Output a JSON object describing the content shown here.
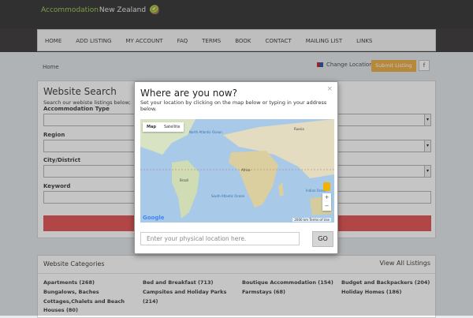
{
  "site": {
    "logo_green": "Accommodation",
    "logo_white": " New Zealand",
    "logo_icon": "kiwi-icon"
  },
  "nav": [
    "HOME",
    "ADD LISTING",
    "MY ACCOUNT",
    "FAQ",
    "TERMS",
    "BOOK",
    "CONTACT",
    "MAILING LIST",
    "LINKS"
  ],
  "breadcrumb": "Home",
  "change_location": "Change Location",
  "submit_listing": "Submit Listing",
  "facebook": "f",
  "search": {
    "title": "Website Search",
    "subtitle": "Search our webiste listings below;",
    "fields": [
      {
        "label": "Accommodation Type"
      },
      {
        "label": "Region"
      },
      {
        "label": "City/District"
      },
      {
        "label": "Keyword"
      }
    ]
  },
  "categories": {
    "title": "Website Categories",
    "view_all": "View All Listings",
    "items": [
      "Apartments (268)",
      "Bed and Breakfast (713)",
      "Boutique Accommodation (154)",
      "Budget and Backpackers (204)",
      "Bungalows, Baches",
      "Campsites and Holiday Parks",
      "Farmstays (68)",
      "Holiday Homes (186)",
      "Cottages,Chalets and Beach",
      "(214)",
      "Houses (80)"
    ]
  },
  "modal": {
    "title": "Where are you now?",
    "close": "×",
    "subtitle": "Set your location by clicking on the map below or typing in your address below.",
    "map_tab_map": "Map",
    "map_tab_satellite": "Satellite",
    "map_labels": [
      "North Atlantic Ocean",
      "South Atlantic Ocean",
      "Indian Ocean",
      "Africa",
      "Brazil",
      "Russia"
    ],
    "google": "Google",
    "scale": "2000 km",
    "terms": "Terms of Use",
    "input_placeholder": "Enter your physical location here.",
    "go": "GO"
  }
}
